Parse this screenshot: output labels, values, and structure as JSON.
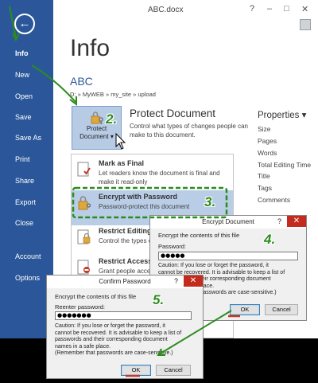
{
  "window": {
    "title": "ABC.docx",
    "help": "?",
    "minimize": "–",
    "restore": "□",
    "close": "✕"
  },
  "sidebar": {
    "back_glyph": "←",
    "items": [
      {
        "label": "Info",
        "active": true
      },
      {
        "label": "New"
      },
      {
        "label": "Open"
      },
      {
        "label": "Save"
      },
      {
        "label": "Save As"
      },
      {
        "label": "Print"
      },
      {
        "label": "Share"
      },
      {
        "label": "Export"
      },
      {
        "label": "Close"
      },
      {
        "label": "Account"
      },
      {
        "label": "Options"
      }
    ]
  },
  "info": {
    "title": "Info",
    "doc_name": "ABC",
    "doc_path": "D: » MyWEB » my_site » upload",
    "protect": {
      "button_label_1": "Protect",
      "button_label_2": "Document ▾",
      "title": "Protect Document",
      "description": "Control what types of changes people can make to this document."
    },
    "menu": [
      {
        "title": "Mark as Final",
        "desc": "Let readers know the document is final and make it read-only"
      },
      {
        "title": "Encrypt with Password",
        "desc": "Password-protect this document"
      },
      {
        "title": "Restrict Editing",
        "desc": "Control the types of changes people can make"
      },
      {
        "title": "Restrict Access",
        "desc": "Grant people access"
      }
    ],
    "properties": {
      "title": "Properties ▾",
      "items": [
        "Size",
        "Pages",
        "Words",
        "Total Editing Time",
        "Title",
        "Tags",
        "Comments"
      ]
    }
  },
  "encrypt_dialog": {
    "title": "Encrypt Document",
    "help": "?",
    "close": "✕",
    "heading": "Encrypt the contents of this file",
    "label": "Password:",
    "value": "●●●●●",
    "caution": [
      "Caution: If you lose or forget the password, it",
      "cannot be recovered. It is advisable to keep a list of",
      "passwords and their corresponding document",
      "names in a safe place.",
      "(Remember that passwords are case-sensitive.)"
    ],
    "ok": "OK",
    "cancel": "Cancel"
  },
  "confirm_dialog": {
    "title": "Confirm Password",
    "help": "?",
    "close": "✕",
    "heading": "Encrypt the contents of this file",
    "label": "Reenter password:",
    "value": "●●●●●●●",
    "caution": [
      "Caution: If you lose or forget the password, it",
      "cannot be recovered. It is advisable to keep a list of",
      "passwords and their corresponding document",
      "names in a safe place.",
      "(Remember that passwords are case-sensitive.)"
    ],
    "ok": "OK",
    "cancel": "Cancel"
  },
  "annotations": {
    "step2": "2.",
    "step3": "3.",
    "step4": "4.",
    "step5": "5.",
    "color": "#2b8c1d"
  },
  "colors": {
    "sidebar": "#2b579a",
    "accent": "#2b579a",
    "highlight": "#b9cde6",
    "close_button": "#c42b1c"
  }
}
